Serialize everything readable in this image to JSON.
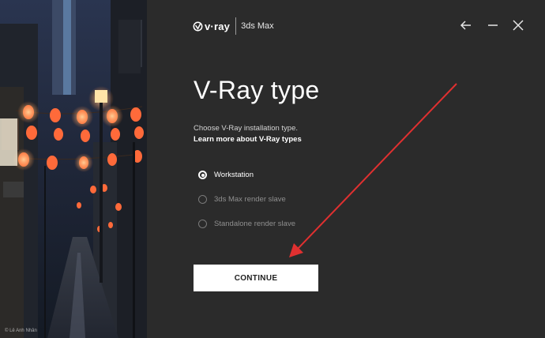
{
  "header": {
    "brand": "v·ray",
    "product": "3ds Max"
  },
  "photo": {
    "credit": "© Lê Anh Nhân"
  },
  "main": {
    "title": "V-Ray type",
    "subtitle": "Choose V-Ray installation type.",
    "learn_more": "Learn more about V-Ray types",
    "options": [
      {
        "label": "Workstation",
        "selected": true
      },
      {
        "label": "3ds Max render slave",
        "selected": false
      },
      {
        "label": "Standalone render slave",
        "selected": false
      }
    ],
    "continue_label": "CONTINUE"
  },
  "icons": {
    "back": "arrow-left-icon",
    "minimize": "minimize-icon",
    "close": "close-icon"
  },
  "colors": {
    "background": "#2b2b2b",
    "button": "#ffffff",
    "annotation_arrow": "#e03030"
  }
}
